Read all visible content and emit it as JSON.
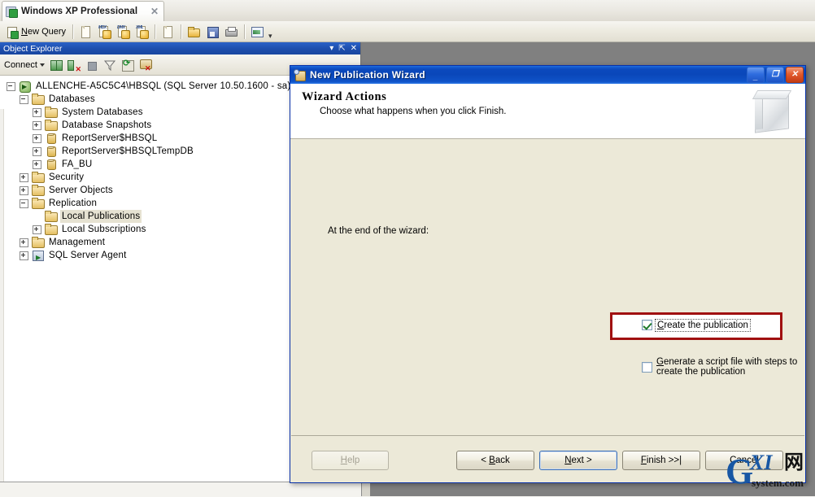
{
  "app": {
    "tab": {
      "label": "Windows XP Professional",
      "close": "✕"
    },
    "toolbar": {
      "new_query": "New Query",
      "new_query_mnemonic": "N",
      "buttons": [
        "new-query-button",
        "new-file-button",
        "new-mdf-query-button",
        "new-dmx-query-button",
        "new-mdx-query-button",
        "new-blank-file-button",
        "open-file-button",
        "save-button",
        "print-button",
        "chart-button"
      ],
      "overflow": "▾"
    }
  },
  "object_explorer": {
    "title": "Object Explorer",
    "title_actions": [
      "dropdown-icon",
      "pin-icon",
      "close-icon"
    ],
    "toolbar": {
      "connect": "Connect",
      "connect_caret": "▾",
      "buttons": [
        "connect-icon",
        "disconnect-icon",
        "stop-icon",
        "filter-icon",
        "refresh-icon",
        "report-icon"
      ]
    },
    "tree": [
      {
        "label": "ALLENCHE-A5C5C4\\HBSQL  (SQL Server 10.50.1600 - sa)",
        "indent": 0,
        "expander": "minus",
        "icon": "server-icon",
        "selected": false
      },
      {
        "label": "Databases",
        "indent": 1,
        "expander": "minus",
        "icon": "folder-icon",
        "selected": false
      },
      {
        "label": "System Databases",
        "indent": 2,
        "expander": "plus",
        "icon": "folder-icon",
        "selected": false
      },
      {
        "label": "Database Snapshots",
        "indent": 2,
        "expander": "plus",
        "icon": "folder-icon",
        "selected": false
      },
      {
        "label": "ReportServer$HBSQL",
        "indent": 2,
        "expander": "plus",
        "icon": "database-icon",
        "selected": false
      },
      {
        "label": "ReportServer$HBSQLTempDB",
        "indent": 2,
        "expander": "plus",
        "icon": "database-icon",
        "selected": false
      },
      {
        "label": "FA_BU",
        "indent": 2,
        "expander": "plus",
        "icon": "database-icon",
        "selected": false
      },
      {
        "label": "Security",
        "indent": 1,
        "expander": "plus",
        "icon": "folder-icon",
        "selected": false
      },
      {
        "label": "Server Objects",
        "indent": 1,
        "expander": "plus",
        "icon": "folder-icon",
        "selected": false
      },
      {
        "label": "Replication",
        "indent": 1,
        "expander": "minus",
        "icon": "folder-icon",
        "selected": false
      },
      {
        "label": "Local Publications",
        "indent": 2,
        "expander": "none",
        "icon": "folder-icon",
        "selected": true
      },
      {
        "label": "Local Subscriptions",
        "indent": 2,
        "expander": "plus",
        "icon": "folder-icon",
        "selected": false
      },
      {
        "label": "Management",
        "indent": 1,
        "expander": "plus",
        "icon": "folder-icon",
        "selected": false
      },
      {
        "label": "SQL Server Agent",
        "indent": 1,
        "expander": "plus",
        "icon": "agent-icon",
        "selected": false
      }
    ]
  },
  "dialog": {
    "title": "New Publication Wizard",
    "window_buttons": {
      "minimize": "_",
      "maximize": "❐",
      "close": "✕"
    },
    "header": {
      "heading": "Wizard Actions",
      "subheading": "Choose what happens when you click Finish."
    },
    "intro": "At the end of the wizard:",
    "options": [
      {
        "label": "Create the publication",
        "mnemonic": "C",
        "checked": true,
        "focused": true,
        "highlighted": true
      },
      {
        "label": "Generate a script file with steps to create the publication",
        "mnemonic": "G",
        "checked": false,
        "focused": false,
        "highlighted": false
      }
    ],
    "buttons": [
      {
        "name": "help-button",
        "label": "Help",
        "mnemonic": "H",
        "disabled": true,
        "default": false
      },
      {
        "name": "back-button",
        "label": "< Back",
        "mnemonic": "B",
        "disabled": false,
        "default": false
      },
      {
        "name": "next-button",
        "label": "Next >",
        "mnemonic": "N",
        "disabled": false,
        "default": true
      },
      {
        "name": "finish-button",
        "label": "Finish >>|",
        "mnemonic": "F",
        "disabled": false,
        "default": false
      },
      {
        "name": "cancel-button",
        "label": "Cancel",
        "mnemonic": "C",
        "disabled": false,
        "default": false
      }
    ],
    "highlight_color": "#a01010"
  },
  "watermark": {
    "g": "G",
    "xi": "XI",
    "cn": "网",
    "domain": "system.com"
  }
}
